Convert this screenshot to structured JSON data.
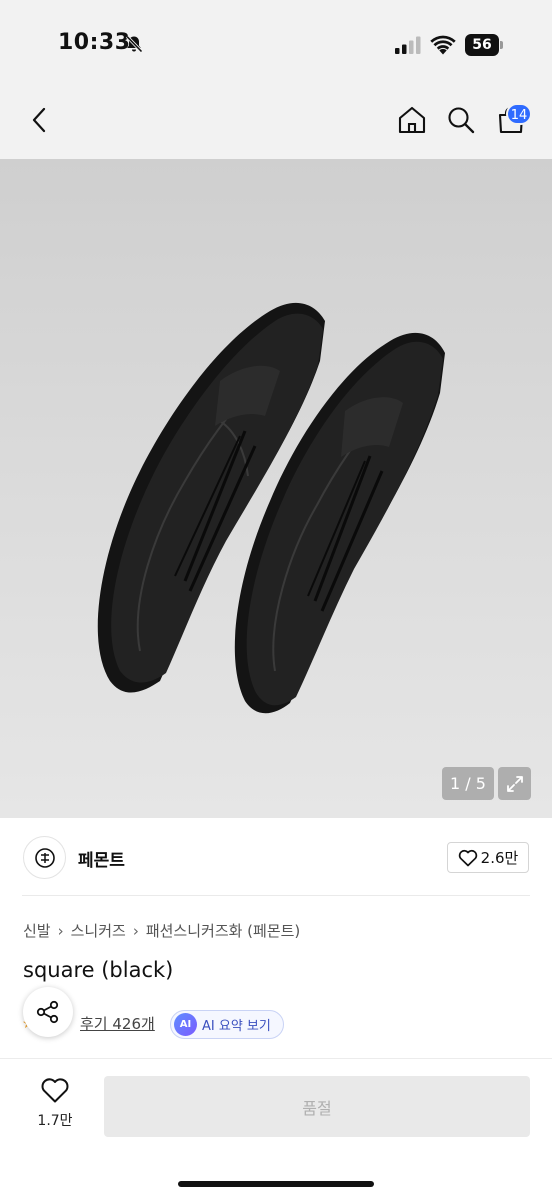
{
  "status_bar": {
    "time": "10:33",
    "battery": "56",
    "icons": [
      "bell-off-icon",
      "signal-icon",
      "wifi-icon",
      "battery-icon"
    ]
  },
  "header": {
    "back_icon": "chevron-left-icon",
    "home_icon": "home-icon",
    "search_icon": "search-icon",
    "cart_icon": "shopping-bag-icon",
    "cart_count": "14"
  },
  "gallery": {
    "current": "1",
    "total": "5",
    "pager_text": "1 / 5",
    "expand_icon": "expand-icon"
  },
  "brand": {
    "name": "페몬트",
    "like_count": "2.6만",
    "logo_icon": "brand-logo-icon"
  },
  "breadcrumb": [
    "신발",
    "스니커즈",
    "패션스니커즈화 (페몬트)"
  ],
  "product": {
    "title": "square (black)"
  },
  "reviews": {
    "link_text": "후기 426개",
    "ai_badge": "AI",
    "ai_label": "AI 요약 보기"
  },
  "bottom_bar": {
    "like_count": "1.7만",
    "buy_label": "품절"
  },
  "colors": {
    "accent_blue": "#2f6bff",
    "soldout_bg": "#e9e9e9",
    "soldout_text": "#b0b0b0"
  }
}
